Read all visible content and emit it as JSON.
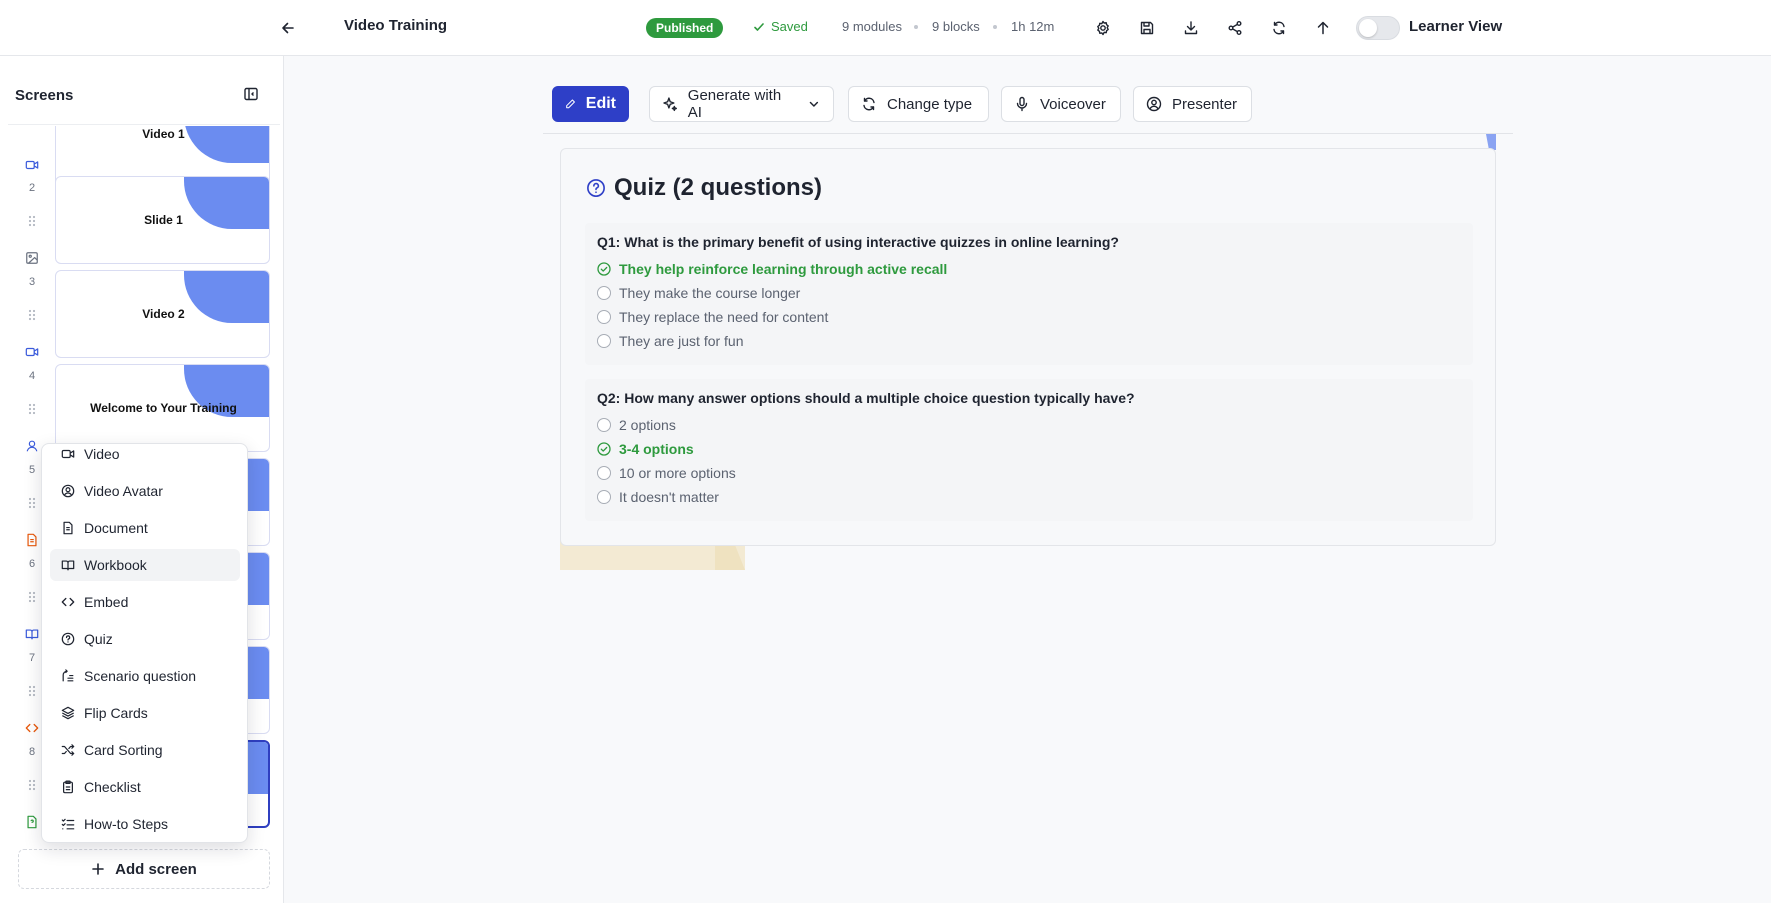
{
  "header": {
    "title": "Video Training",
    "status_badge": "Published",
    "saved_text": "Saved",
    "stats": {
      "modules": "9 modules",
      "blocks": "9 blocks",
      "duration": "1h 12m"
    },
    "learner_view_label": "Learner View",
    "learner_view_on": false
  },
  "sidebar": {
    "title": "Screens",
    "screens": [
      {
        "label": "Video 1",
        "type_icon": "video-icon"
      },
      {
        "number": "2",
        "label": "Slide 1",
        "type_icon": "image-icon"
      },
      {
        "number": "3",
        "label": "Video 2",
        "type_icon": "video-icon"
      },
      {
        "number": "4",
        "label": "Welcome to Your Training",
        "type_icon": "avatar-icon"
      },
      {
        "number": "5",
        "type_icon": "document-icon"
      },
      {
        "number": "6",
        "type_icon": "workbook-icon"
      },
      {
        "number": "7",
        "type_icon": "embed-icon"
      },
      {
        "number": "8",
        "type_icon": "quiz-icon",
        "selected": true
      }
    ],
    "add_screen_label": "Add screen"
  },
  "add_menu": {
    "items": [
      {
        "label": "Video",
        "icon": "video-icon"
      },
      {
        "label": "Video Avatar",
        "icon": "avatar-icon"
      },
      {
        "label": "Document",
        "icon": "document-icon"
      },
      {
        "label": "Workbook",
        "icon": "workbook-icon",
        "hovered": true
      },
      {
        "label": "Embed",
        "icon": "embed-icon"
      },
      {
        "label": "Quiz",
        "icon": "quiz-icon"
      },
      {
        "label": "Scenario question",
        "icon": "scenario-icon"
      },
      {
        "label": "Flip Cards",
        "icon": "layers-icon"
      },
      {
        "label": "Card Sorting",
        "icon": "shuffle-icon"
      },
      {
        "label": "Checklist",
        "icon": "clipboard-icon"
      },
      {
        "label": "How-to Steps",
        "icon": "list-checks-icon"
      }
    ]
  },
  "toolbar": {
    "edit_label": "Edit",
    "generate_label": "Generate with AI",
    "change_type_label": "Change type",
    "voiceover_label": "Voiceover",
    "presenter_label": "Presenter"
  },
  "quiz": {
    "title": "Quiz (2 questions)",
    "questions": [
      {
        "text": "Q1: What is the primary benefit of using interactive quizzes in online learning?",
        "options": [
          {
            "text": "They help reinforce learning through active recall",
            "correct": true
          },
          {
            "text": "They make the course longer",
            "correct": false
          },
          {
            "text": "They replace the need for content",
            "correct": false
          },
          {
            "text": "They are just for fun",
            "correct": false
          }
        ]
      },
      {
        "text": "Q2: How many answer options should a multiple choice question typically have?",
        "options": [
          {
            "text": "2 options",
            "correct": false
          },
          {
            "text": "3-4 options",
            "correct": true
          },
          {
            "text": "10 or more options",
            "correct": false
          },
          {
            "text": "It doesn't matter",
            "correct": false
          }
        ]
      }
    ]
  },
  "colors": {
    "accent": "#2e3fc7",
    "success": "#2e9a3e",
    "thumb_blob": "#6b8cf0"
  }
}
